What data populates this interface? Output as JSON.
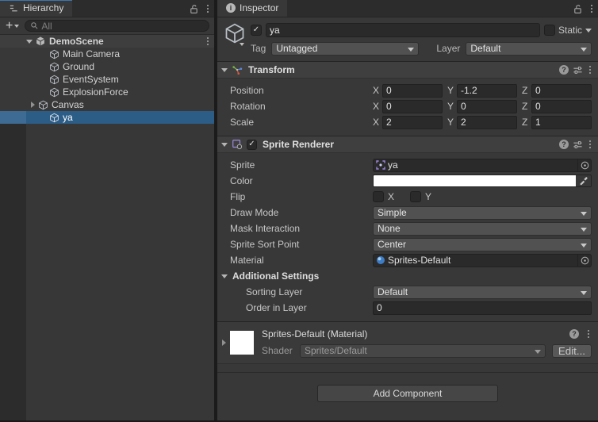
{
  "colors": {
    "accent_focus": "#3C76B0",
    "selection": "#2C5D87",
    "panel_bg": "#383838",
    "field_bg": "#2A2A2A",
    "dropdown_bg": "#515151",
    "sprite_color_value": "#FFFFFF"
  },
  "hierarchy": {
    "tab": "Hierarchy",
    "search_placeholder": "All",
    "scene": {
      "label": "DemoScene"
    },
    "items": [
      {
        "label": "Main Camera"
      },
      {
        "label": "Ground"
      },
      {
        "label": "EventSystem"
      },
      {
        "label": "ExplosionForce"
      },
      {
        "label": "Canvas"
      },
      {
        "label": "ya"
      }
    ]
  },
  "inspector": {
    "tab": "Inspector",
    "header": {
      "name": "ya",
      "static_label": "Static",
      "tag_label": "Tag",
      "tag_value": "Untagged",
      "layer_label": "Layer",
      "layer_value": "Default"
    },
    "transform": {
      "title": "Transform",
      "axis_labels": [
        "X",
        "Y",
        "Z"
      ],
      "rows": [
        {
          "label": "Position",
          "x": "0",
          "y": "-1.2",
          "z": "0"
        },
        {
          "label": "Rotation",
          "x": "0",
          "y": "0",
          "z": "0"
        },
        {
          "label": "Scale",
          "x": "2",
          "y": "2",
          "z": "1"
        }
      ]
    },
    "sprite_renderer": {
      "title": "Sprite Renderer",
      "sprite_label": "Sprite",
      "sprite_value": "ya",
      "color_label": "Color",
      "flip_label": "Flip",
      "flip_x": "X",
      "flip_y": "Y",
      "draw_mode_label": "Draw Mode",
      "draw_mode_value": "Simple",
      "mask_label": "Mask Interaction",
      "mask_value": "None",
      "sort_point_label": "Sprite Sort Point",
      "sort_point_value": "Center",
      "material_label": "Material",
      "material_value": "Sprites-Default",
      "additional_label": "Additional Settings",
      "sorting_layer_label": "Sorting Layer",
      "sorting_layer_value": "Default",
      "order_label": "Order in Layer",
      "order_value": "0"
    },
    "material_preview": {
      "title": "Sprites-Default (Material)",
      "shader_label": "Shader",
      "shader_value": "Sprites/Default",
      "edit_button": "Edit..."
    },
    "add_component": "Add Component"
  }
}
